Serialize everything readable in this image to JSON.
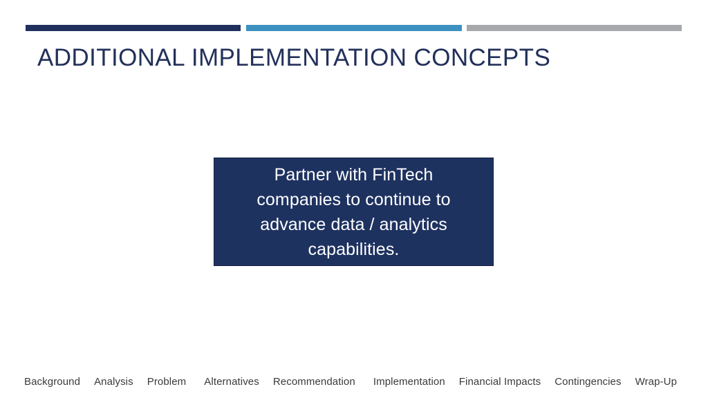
{
  "slide": {
    "title": "ADDITIONAL IMPLEMENTATION CONCEPTS",
    "background_color": "#ffffff"
  },
  "top_rule": {
    "segments": [
      {
        "name": "navy",
        "color": "#1f2f5e"
      },
      {
        "name": "blue",
        "color": "#3c91c0"
      },
      {
        "name": "gray",
        "color": "#a6a8ab"
      }
    ]
  },
  "callout": {
    "text": "Partner with FinTech companies to continue to advance data / analytics capabilities.",
    "fill_color": "#1e3260",
    "text_color": "#ffffff"
  },
  "section_nav": {
    "items": [
      {
        "label": "Background"
      },
      {
        "label": "Analysis"
      },
      {
        "label": "Problem"
      },
      {
        "label": "Alternatives"
      },
      {
        "label": "Recommendation"
      },
      {
        "label": "Implementation"
      },
      {
        "label": "Financial Impacts"
      },
      {
        "label": "Contingencies"
      },
      {
        "label": "Wrap-Up"
      }
    ],
    "text_color": "#3a3a3a"
  }
}
